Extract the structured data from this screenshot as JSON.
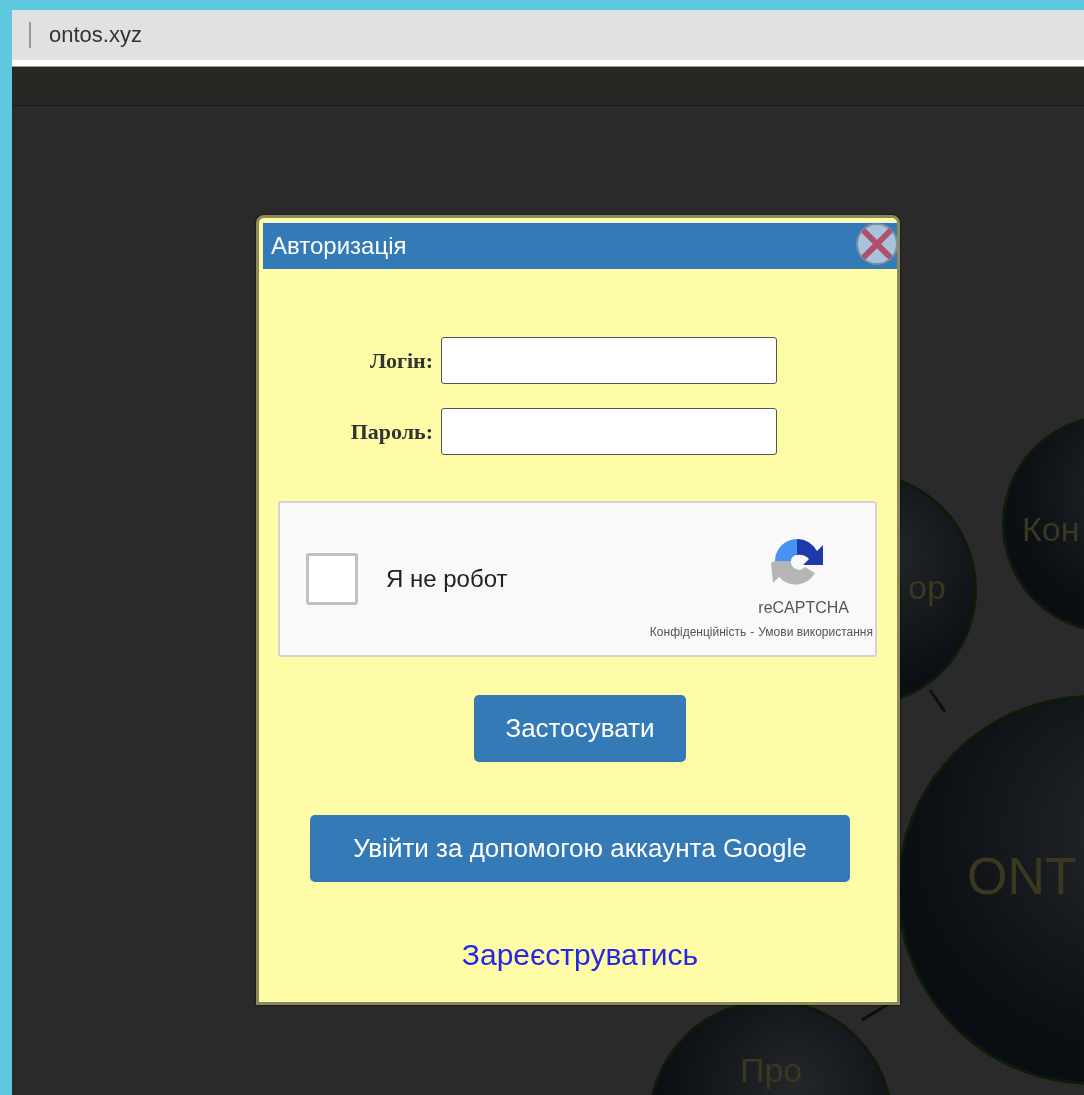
{
  "browser": {
    "address": "ontos.xyz"
  },
  "background_nodes": [
    {
      "label": "ор"
    },
    {
      "label": "Кон"
    },
    {
      "label": "ONT"
    },
    {
      "label": "Про"
    }
  ],
  "dialog": {
    "title": "Авторизація",
    "fields": [
      {
        "label": "Логін:"
      },
      {
        "label": "Пароль:"
      }
    ],
    "captcha": {
      "label": "Я не робот",
      "checked": false,
      "brand": "reCAPTCHA",
      "privacy_link": "Конфіденційність",
      "separator": "-",
      "terms_link": "Умови використання"
    },
    "apply_button": "Застосувати",
    "google_button": "Увійти за допомогою аккаунта Google",
    "register_link": "Зареєструватись"
  }
}
